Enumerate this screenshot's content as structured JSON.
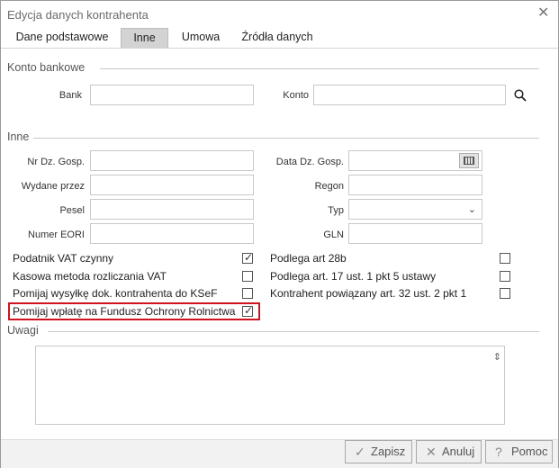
{
  "window": {
    "title": "Edycja danych kontrahenta",
    "close_glyph": "✕"
  },
  "tabs": [
    {
      "label": "Dane podstawowe"
    },
    {
      "label": "Inne"
    },
    {
      "label": "Umowa"
    },
    {
      "label": "Źródła danych"
    }
  ],
  "konto": {
    "section": "Konto bankowe",
    "bank_label": "Bank",
    "bank_value": "",
    "konto_label": "Konto",
    "konto_value": "",
    "search_icon": "search-icon"
  },
  "inne": {
    "section": "Inne",
    "nr_dz_gosp_label": "Nr Dz. Gosp.",
    "data_dz_gosp_label": "Data Dz. Gosp.",
    "wydane_przez_label": "Wydane przez",
    "regon_label": "Regon",
    "pesel_label": "Pesel",
    "typ_label": "Typ",
    "typ_value": "",
    "numer_eori_label": "Numer EORI",
    "gln_label": "GLN"
  },
  "checkboxes_left": [
    {
      "label": "Podatnik VAT czynny",
      "checked": true
    },
    {
      "label": "Kasowa metoda rozliczania VAT",
      "checked": false
    },
    {
      "label": "Pomijaj wysyłkę dok. kontrahenta do KSeF",
      "checked": false
    },
    {
      "label": "Pomijaj wpłatę na Fundusz Ochrony Rolnictwa",
      "checked": true
    }
  ],
  "checkboxes_right": [
    {
      "label": "Podlega art 28b",
      "checked": false
    },
    {
      "label": "Podlega art. 17 ust. 1 pkt 5 ustawy",
      "checked": false
    },
    {
      "label": "Kontrahent powiązany art. 32 ust. 2 pkt 1",
      "checked": false
    }
  ],
  "uwagi": {
    "section": "Uwagi",
    "value": ""
  },
  "buttons": {
    "zapisz": "Zapisz",
    "anuluj": "Anuluj",
    "pomoc": "Pomoc"
  },
  "colors": {
    "highlight": "#d0141f",
    "active_tab": "#d3d3d3"
  },
  "tick_glyph": "✓",
  "chevron_glyph": "⌄",
  "grip_glyph": "⇕",
  "button_icons": {
    "zapisz": "✓",
    "anuluj": "✕",
    "pomoc": "?"
  }
}
